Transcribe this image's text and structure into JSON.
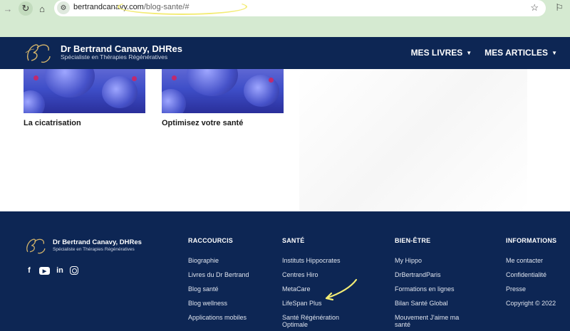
{
  "browser": {
    "url_domain": "bertrandcanavy.com",
    "url_path": "/blog-sante/#",
    "icons": [
      "back-icon",
      "reload-icon",
      "home-icon",
      "site-info-icon",
      "bookmark-star-icon",
      "extensions-icon"
    ]
  },
  "header": {
    "brand_name": "Dr Bertrand Canavy, DHRes",
    "brand_subtitle": "Spécialiste en Thérapies Régénératives",
    "menu": [
      {
        "label": "MES LIVRES"
      },
      {
        "label": "MES ARTICLES"
      }
    ]
  },
  "content": {
    "cards": [
      {
        "title": "La cicatrisation"
      },
      {
        "title": "Optimisez votre santé"
      }
    ]
  },
  "footer": {
    "brand_name": "Dr Bertrand Canavy, DHRes",
    "brand_subtitle": "Spécialiste en Thérapies Régénératives",
    "socials": [
      "facebook-icon",
      "youtube-icon",
      "linkedin-icon",
      "instagram-icon"
    ],
    "columns": [
      {
        "heading": "RACCOURCIS",
        "links": [
          "Biographie",
          "Livres du Dr Bertrand",
          "Blog santé",
          "Blog wellness",
          "Applications mobiles"
        ]
      },
      {
        "heading": "SANTÉ",
        "links": [
          "Instituts Hippocrates",
          "Centres Hiro",
          "MetaCare",
          "LifeSpan Plus",
          "Santé Régénération Optimale"
        ]
      },
      {
        "heading": "BIEN-ÊTRE",
        "links": [
          "My Hippo",
          "DrBertrandParis",
          "Formations en lignes",
          "Bilan Santé Global",
          "Mouvement J'aime ma santé"
        ]
      },
      {
        "heading": "INFORMATIONS",
        "links": [
          "Me contacter",
          "Confidentialité",
          "Presse",
          "Copyright © 2022"
        ]
      }
    ]
  },
  "colors": {
    "navy": "#0d2654",
    "chrome_green": "#d5ead1",
    "annotation_yellow": "#f3ec75",
    "logo_gold": "#d4b46a"
  }
}
